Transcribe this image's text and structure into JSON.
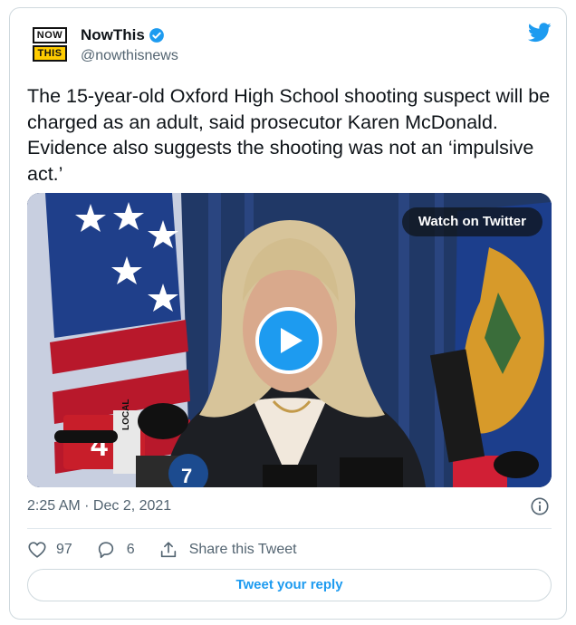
{
  "account": {
    "logo_line1": "NOW",
    "logo_line2": "THIS",
    "name": "NowThis",
    "handle": "@nowthisnews",
    "verified_icon": "verified-badge-icon",
    "brand_icon": "twitter-bird-icon"
  },
  "tweet": {
    "text": "The 15-year-old Oxford High School shooting suspect will be charged as an adult, said prosecutor Karen McDonald. Evidence also suggests the shooting was not an ‘impulsive act.’",
    "timestamp": "2:25 AM · Dec 2, 2021"
  },
  "media": {
    "watch_label": "Watch on Twitter",
    "mic_label_1": "LOCAL",
    "mic_number_1": "4",
    "mic_number_2": "7"
  },
  "actions": {
    "likes": "97",
    "replies": "6",
    "share_label": "Share this Tweet",
    "reply_button": "Tweet your reply"
  },
  "colors": {
    "accent": "#1d9bf0",
    "text_primary": "#0f1419",
    "text_secondary": "#536471",
    "border": "#cfd9de"
  }
}
